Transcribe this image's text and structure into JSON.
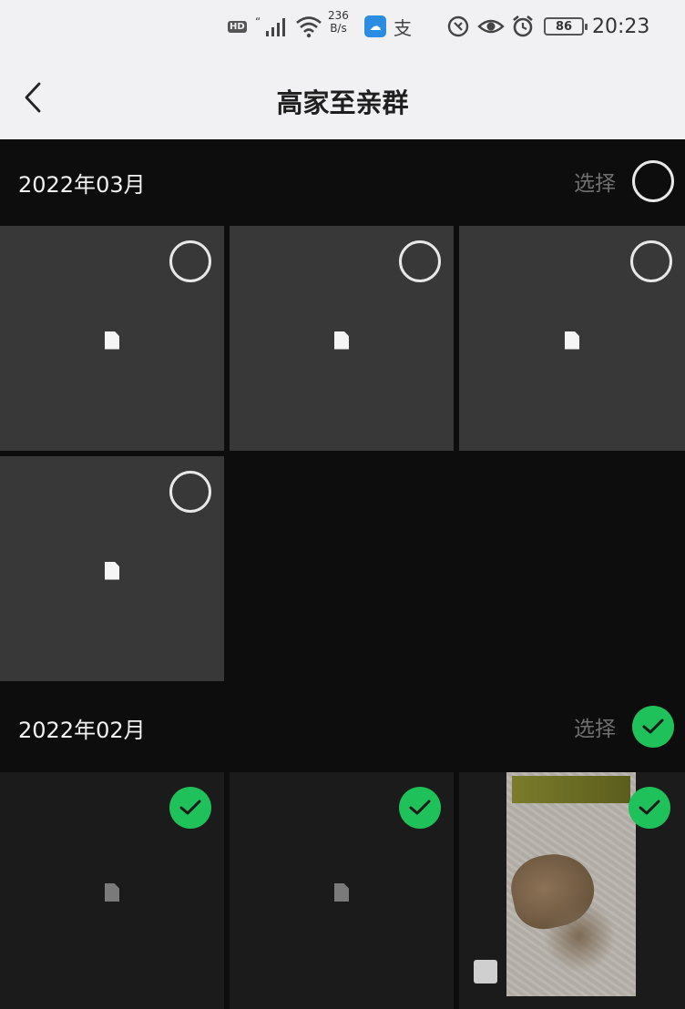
{
  "status_bar": {
    "hd": "HD",
    "net_speed_value": "236",
    "net_speed_unit": "B/s",
    "app_icon_text": "☁",
    "alipay_char": "支",
    "battery": "86",
    "time": "20:23"
  },
  "nav": {
    "title": "高家至亲群"
  },
  "sections": [
    {
      "date": "2022年03月",
      "select_label": "选择",
      "selected": false
    },
    {
      "date": "2022年02月",
      "select_label": "选择",
      "selected": true
    }
  ],
  "colors": {
    "accent_green": "#1fc15a",
    "background": "#0d0d0d",
    "tile": "#383838"
  },
  "icons": [
    "back-arrow-icon",
    "file-icon",
    "check-icon",
    "select-circle-icon",
    "wifi-icon",
    "signal-icon",
    "eye-icon",
    "alarm-icon"
  ]
}
